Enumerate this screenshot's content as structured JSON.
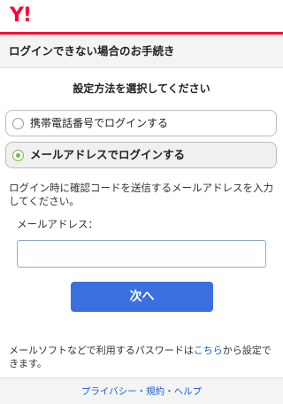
{
  "header": {
    "logo_text": "Y!"
  },
  "page": {
    "title": "ログインできない場合のお手続き"
  },
  "main": {
    "subheading": "設定方法を選択してください",
    "options": [
      {
        "label": "携帯電話番号でログインする",
        "selected": false
      },
      {
        "label": "メールアドレスでログインする",
        "selected": true
      }
    ],
    "description": "ログイン時に確認コードを送信するメールアドレスを入力してください。",
    "email_label": "メールアドレス：",
    "email_value": "",
    "next_button": "次へ",
    "note_before": "メールソフトなどで利用するパスワードは",
    "note_link": "こちら",
    "note_after": "から設定できます。"
  },
  "footer": {
    "links": [
      "プライバシー",
      "規約",
      "ヘルプ"
    ],
    "separator": "・"
  },
  "colors": {
    "brand": "#ff0033",
    "primary_button": "#3b6fe0",
    "link": "#1a5fd0",
    "radio_selected": "#6bbd4a"
  }
}
